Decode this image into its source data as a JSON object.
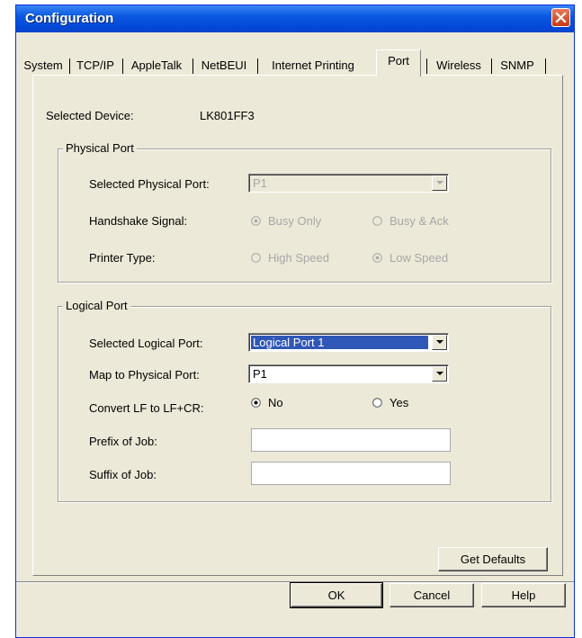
{
  "window": {
    "title": "Configuration"
  },
  "tabs": [
    {
      "label": "System"
    },
    {
      "label": "TCP/IP"
    },
    {
      "label": "AppleTalk"
    },
    {
      "label": "NetBEUI"
    },
    {
      "label": "Internet Printing"
    },
    {
      "label": "Port"
    },
    {
      "label": "Wireless"
    },
    {
      "label": "SNMP"
    }
  ],
  "active_tab": "Port",
  "device": {
    "label": "Selected Device:",
    "value": "LK801FF3"
  },
  "physical_port": {
    "title": "Physical Port",
    "selected_port_label": "Selected Physical Port:",
    "selected_port_value": "P1",
    "handshake_label": "Handshake Signal:",
    "handshake_options": [
      {
        "label": "Busy Only",
        "checked": true
      },
      {
        "label": "Busy & Ack",
        "checked": false
      }
    ],
    "printer_type_label": "Printer Type:",
    "printer_type_options": [
      {
        "label": "High Speed",
        "checked": false
      },
      {
        "label": "Low Speed",
        "checked": true
      }
    ],
    "enabled": false
  },
  "logical_port": {
    "title": "Logical Port",
    "selected_port_label": "Selected Logical Port:",
    "selected_port_value": "Logical Port 1",
    "map_label": "Map to Physical Port:",
    "map_value": "P1",
    "convert_label": "Convert LF to LF+CR:",
    "convert_options": [
      {
        "label": "No",
        "checked": true
      },
      {
        "label": "Yes",
        "checked": false
      }
    ],
    "prefix_label": "Prefix of Job:",
    "prefix_value": "",
    "suffix_label": "Suffix of Job:",
    "suffix_value": ""
  },
  "buttons": {
    "get_defaults": "Get Defaults",
    "ok": "OK",
    "cancel": "Cancel",
    "help": "Help"
  },
  "colors": {
    "titlebar": "#0a58e0",
    "dialog_bg": "#ece9d8",
    "selection": "#2f57b7"
  }
}
